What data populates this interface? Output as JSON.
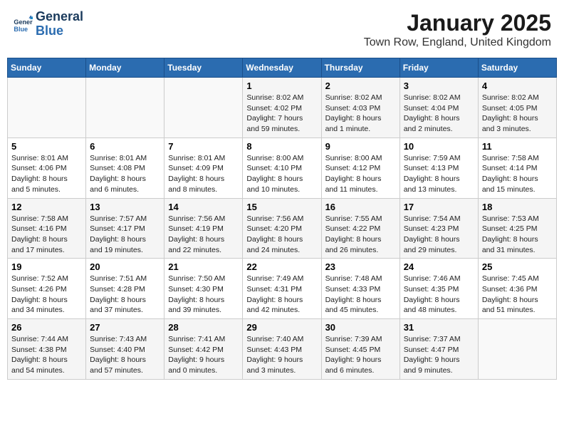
{
  "header": {
    "logo_line1": "General",
    "logo_line2": "Blue",
    "title": "January 2025",
    "subtitle": "Town Row, England, United Kingdom"
  },
  "days_of_week": [
    "Sunday",
    "Monday",
    "Tuesday",
    "Wednesday",
    "Thursday",
    "Friday",
    "Saturday"
  ],
  "weeks": [
    [
      {
        "day": "",
        "content": ""
      },
      {
        "day": "",
        "content": ""
      },
      {
        "day": "",
        "content": ""
      },
      {
        "day": "1",
        "content": "Sunrise: 8:02 AM\nSunset: 4:02 PM\nDaylight: 7 hours and 59 minutes."
      },
      {
        "day": "2",
        "content": "Sunrise: 8:02 AM\nSunset: 4:03 PM\nDaylight: 8 hours and 1 minute."
      },
      {
        "day": "3",
        "content": "Sunrise: 8:02 AM\nSunset: 4:04 PM\nDaylight: 8 hours and 2 minutes."
      },
      {
        "day": "4",
        "content": "Sunrise: 8:02 AM\nSunset: 4:05 PM\nDaylight: 8 hours and 3 minutes."
      }
    ],
    [
      {
        "day": "5",
        "content": "Sunrise: 8:01 AM\nSunset: 4:06 PM\nDaylight: 8 hours and 5 minutes."
      },
      {
        "day": "6",
        "content": "Sunrise: 8:01 AM\nSunset: 4:08 PM\nDaylight: 8 hours and 6 minutes."
      },
      {
        "day": "7",
        "content": "Sunrise: 8:01 AM\nSunset: 4:09 PM\nDaylight: 8 hours and 8 minutes."
      },
      {
        "day": "8",
        "content": "Sunrise: 8:00 AM\nSunset: 4:10 PM\nDaylight: 8 hours and 10 minutes."
      },
      {
        "day": "9",
        "content": "Sunrise: 8:00 AM\nSunset: 4:12 PM\nDaylight: 8 hours and 11 minutes."
      },
      {
        "day": "10",
        "content": "Sunrise: 7:59 AM\nSunset: 4:13 PM\nDaylight: 8 hours and 13 minutes."
      },
      {
        "day": "11",
        "content": "Sunrise: 7:58 AM\nSunset: 4:14 PM\nDaylight: 8 hours and 15 minutes."
      }
    ],
    [
      {
        "day": "12",
        "content": "Sunrise: 7:58 AM\nSunset: 4:16 PM\nDaylight: 8 hours and 17 minutes."
      },
      {
        "day": "13",
        "content": "Sunrise: 7:57 AM\nSunset: 4:17 PM\nDaylight: 8 hours and 19 minutes."
      },
      {
        "day": "14",
        "content": "Sunrise: 7:56 AM\nSunset: 4:19 PM\nDaylight: 8 hours and 22 minutes."
      },
      {
        "day": "15",
        "content": "Sunrise: 7:56 AM\nSunset: 4:20 PM\nDaylight: 8 hours and 24 minutes."
      },
      {
        "day": "16",
        "content": "Sunrise: 7:55 AM\nSunset: 4:22 PM\nDaylight: 8 hours and 26 minutes."
      },
      {
        "day": "17",
        "content": "Sunrise: 7:54 AM\nSunset: 4:23 PM\nDaylight: 8 hours and 29 minutes."
      },
      {
        "day": "18",
        "content": "Sunrise: 7:53 AM\nSunset: 4:25 PM\nDaylight: 8 hours and 31 minutes."
      }
    ],
    [
      {
        "day": "19",
        "content": "Sunrise: 7:52 AM\nSunset: 4:26 PM\nDaylight: 8 hours and 34 minutes."
      },
      {
        "day": "20",
        "content": "Sunrise: 7:51 AM\nSunset: 4:28 PM\nDaylight: 8 hours and 37 minutes."
      },
      {
        "day": "21",
        "content": "Sunrise: 7:50 AM\nSunset: 4:30 PM\nDaylight: 8 hours and 39 minutes."
      },
      {
        "day": "22",
        "content": "Sunrise: 7:49 AM\nSunset: 4:31 PM\nDaylight: 8 hours and 42 minutes."
      },
      {
        "day": "23",
        "content": "Sunrise: 7:48 AM\nSunset: 4:33 PM\nDaylight: 8 hours and 45 minutes."
      },
      {
        "day": "24",
        "content": "Sunrise: 7:46 AM\nSunset: 4:35 PM\nDaylight: 8 hours and 48 minutes."
      },
      {
        "day": "25",
        "content": "Sunrise: 7:45 AM\nSunset: 4:36 PM\nDaylight: 8 hours and 51 minutes."
      }
    ],
    [
      {
        "day": "26",
        "content": "Sunrise: 7:44 AM\nSunset: 4:38 PM\nDaylight: 8 hours and 54 minutes."
      },
      {
        "day": "27",
        "content": "Sunrise: 7:43 AM\nSunset: 4:40 PM\nDaylight: 8 hours and 57 minutes."
      },
      {
        "day": "28",
        "content": "Sunrise: 7:41 AM\nSunset: 4:42 PM\nDaylight: 9 hours and 0 minutes."
      },
      {
        "day": "29",
        "content": "Sunrise: 7:40 AM\nSunset: 4:43 PM\nDaylight: 9 hours and 3 minutes."
      },
      {
        "day": "30",
        "content": "Sunrise: 7:39 AM\nSunset: 4:45 PM\nDaylight: 9 hours and 6 minutes."
      },
      {
        "day": "31",
        "content": "Sunrise: 7:37 AM\nSunset: 4:47 PM\nDaylight: 9 hours and 9 minutes."
      },
      {
        "day": "",
        "content": ""
      }
    ]
  ]
}
